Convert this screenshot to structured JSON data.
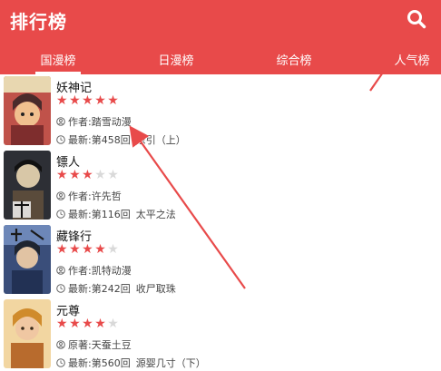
{
  "app": {
    "title": "排行榜",
    "search_icon": "search-icon"
  },
  "colors": {
    "accent": "#e84a4a",
    "star_on": "#e84a4a",
    "star_off": "#d9d9d9"
  },
  "tabs": [
    {
      "label": "国漫榜",
      "selected": true
    },
    {
      "label": "日漫榜",
      "selected": false
    },
    {
      "label": "综合榜",
      "selected": false
    },
    {
      "label": "人气榜",
      "selected": false
    }
  ],
  "items": [
    {
      "title": "妖神记",
      "rating": 5,
      "author_prefix": "作者:",
      "author": "踏雪动漫",
      "latest_prefix": "最新:",
      "latest": "第458回",
      "latest_title": "东引（上）"
    },
    {
      "title": "镖人",
      "rating": 3,
      "author_prefix": "作者:",
      "author": "许先哲",
      "latest_prefix": "最新:",
      "latest": "第116回",
      "latest_title": "太平之法"
    },
    {
      "title": "藏锋行",
      "rating": 4,
      "author_prefix": "作者:",
      "author": "凯特动漫",
      "latest_prefix": "最新:",
      "latest": "第242回",
      "latest_title": "收尸取珠"
    },
    {
      "title": "元尊",
      "rating": 4,
      "author_prefix": "原著:",
      "author": "天蚕土豆",
      "latest_prefix": "最新:",
      "latest": "第560回",
      "latest_title": "源婴几寸（下）"
    }
  ]
}
